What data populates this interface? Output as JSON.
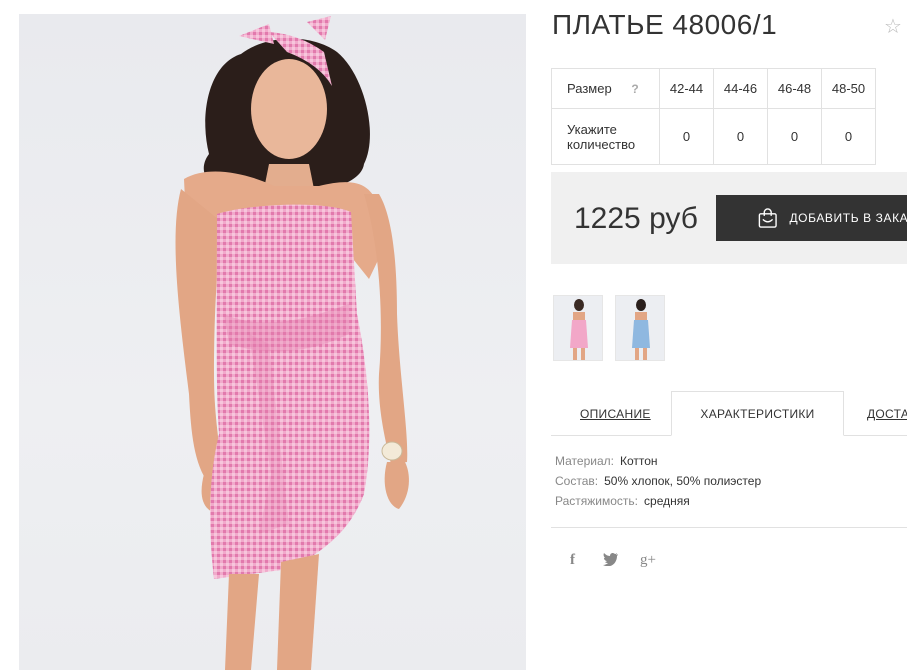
{
  "product": {
    "title": "ПЛАТЬЕ 48006/1",
    "favorite_icon": "star-outline-icon"
  },
  "sizes_table": {
    "size_label": "Размер",
    "help_mark": "?",
    "sizes": [
      "42-44",
      "44-46",
      "46-48",
      "48-50"
    ],
    "quantity_label": "Укажите количество",
    "quantities": [
      "0",
      "0",
      "0",
      "0"
    ]
  },
  "purchase": {
    "price": "1225 руб",
    "add_to_cart_label": "ДОБАВИТЬ В ЗАКАЗ",
    "button_icon": "shopping-bag-icon"
  },
  "thumbnails": [
    {
      "color": "pink",
      "hex": "#f2a7c8"
    },
    {
      "color": "blue",
      "hex": "#8fb8e0"
    }
  ],
  "tabs": [
    {
      "label": "ОПИСАНИЕ",
      "active": false
    },
    {
      "label": "ХАРАКТЕРИСТИКИ",
      "active": true
    },
    {
      "label": "ДОСТАВКА",
      "active": false
    }
  ],
  "characteristics": [
    {
      "key": "Материал:",
      "value": "Коттон"
    },
    {
      "key": "Состав:",
      "value": "50% хлопок, 50% полиэстер"
    },
    {
      "key": "Растяжимость:",
      "value": "средняя"
    }
  ],
  "social": {
    "facebook": "f",
    "twitter": "twitter-bird-icon",
    "google_plus": "g+"
  },
  "colors": {
    "dark_button": "#333333",
    "price_bg": "#f0f0f0",
    "dress_pink": "#f2a7c8"
  }
}
